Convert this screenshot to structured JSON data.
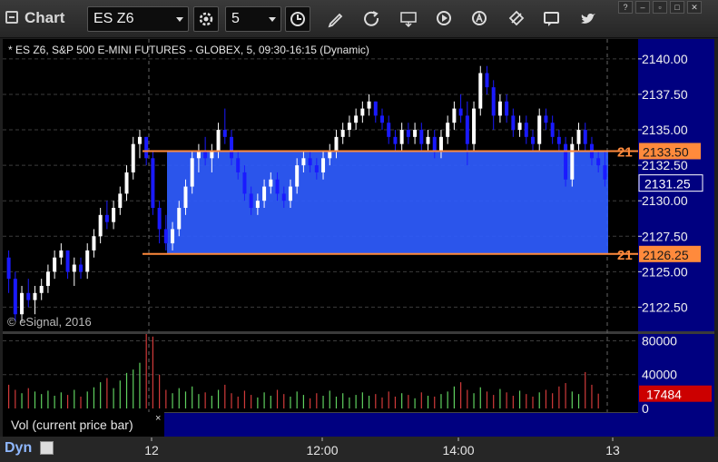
{
  "toolbar": {
    "title": "Chart",
    "symbol": "ES Z6",
    "interval": "5",
    "buttons": [
      "settings-icon",
      "clock-icon",
      "pencil-icon",
      "refresh-icon",
      "get-icon",
      "play-icon",
      "alert-icon",
      "crosshair-icon",
      "comment-icon",
      "twitter-icon"
    ],
    "window_buttons": [
      "help-icon",
      "minimize-icon",
      "maximize-icon",
      "close-icon"
    ]
  },
  "header": {
    "info": "* ES Z6, S&P 500 E-MINI FUTURES - GLOBEX, 5, 09:30-16:15 (Dynamic)",
    "copyright": "© eSignal, 2016"
  },
  "volume_pane": {
    "label": "Vol (current price bar)",
    "close_label": "×",
    "current_value": "17484"
  },
  "footer": {
    "dyn_label": "Dyn"
  },
  "colors": {
    "up": "#ffffff",
    "down": "#1a1aff",
    "box_fill": "#2f5cff",
    "level_line": "#ff8a3c",
    "vol_up": "#5fd15f",
    "vol_down": "#d13a3a",
    "axis_bg": "#000080",
    "current_price_bg": "#000080",
    "vol_value_bg": "#cc0000"
  },
  "chart_data": {
    "type": "candlestick",
    "y_axis": {
      "ticks": [
        "2140.00",
        "2137.50",
        "2135.00",
        "2132.50",
        "2130.00",
        "2127.50",
        "2125.00",
        "2122.50"
      ],
      "range": [
        2120.8,
        2141.4
      ]
    },
    "x_axis": {
      "ticks": [
        "12",
        "12:00",
        "14:00",
        "13"
      ]
    },
    "levels": [
      {
        "label": "2133.50",
        "price": 2133.5,
        "marker": "21"
      },
      {
        "label": "2126.25",
        "price": 2126.25,
        "marker": "21"
      }
    ],
    "current_price": {
      "label": "2131.25",
      "price": 2131.25
    },
    "volume_axis": {
      "ticks": [
        "80000",
        "40000",
        "0"
      ],
      "max": 88000
    },
    "candles": [
      [
        2126.0,
        2126.5,
        2123.5,
        2124.5
      ],
      [
        2124.5,
        2125.0,
        2121.5,
        2122.0
      ],
      [
        2122.0,
        2124.0,
        2121.5,
        2123.5
      ],
      [
        2123.5,
        2124.5,
        2122.5,
        2123.0
      ],
      [
        2123.0,
        2124.0,
        2122.0,
        2123.5
      ],
      [
        2123.5,
        2124.5,
        2123.0,
        2124.0
      ],
      [
        2124.0,
        2125.5,
        2123.5,
        2125.0
      ],
      [
        2125.0,
        2126.5,
        2124.5,
        2126.0
      ],
      [
        2126.0,
        2127.0,
        2125.5,
        2126.5
      ],
      [
        2126.5,
        2126.5,
        2124.5,
        2125.0
      ],
      [
        2125.0,
        2126.0,
        2124.0,
        2125.5
      ],
      [
        2125.5,
        2126.0,
        2124.5,
        2125.0
      ],
      [
        2125.0,
        2127.0,
        2124.5,
        2126.5
      ],
      [
        2126.5,
        2128.0,
        2126.0,
        2127.5
      ],
      [
        2127.5,
        2129.5,
        2127.0,
        2129.0
      ],
      [
        2129.0,
        2130.0,
        2128.0,
        2128.5
      ],
      [
        2128.5,
        2130.0,
        2128.0,
        2129.5
      ],
      [
        2129.5,
        2131.0,
        2129.0,
        2130.5
      ],
      [
        2130.5,
        2132.5,
        2130.0,
        2132.0
      ],
      [
        2132.0,
        2134.5,
        2131.5,
        2134.0
      ],
      [
        2134.0,
        2135.0,
        2133.0,
        2134.5
      ],
      [
        2134.5,
        2134.5,
        2132.5,
        2133.0
      ],
      [
        2133.0,
        2133.5,
        2129.0,
        2129.5
      ],
      [
        2129.5,
        2130.0,
        2127.0,
        2128.0
      ],
      [
        2128.0,
        2129.0,
        2126.5,
        2127.0
      ],
      [
        2127.0,
        2128.5,
        2126.5,
        2128.0
      ],
      [
        2128.0,
        2130.0,
        2127.5,
        2129.5
      ],
      [
        2129.5,
        2131.5,
        2129.0,
        2131.0
      ],
      [
        2131.0,
        2133.5,
        2130.5,
        2133.0
      ],
      [
        2133.0,
        2134.0,
        2132.0,
        2133.5
      ],
      [
        2133.5,
        2134.5,
        2132.5,
        2133.0
      ],
      [
        2133.0,
        2134.0,
        2132.0,
        2133.5
      ],
      [
        2133.5,
        2135.5,
        2133.0,
        2135.0
      ],
      [
        2135.0,
        2136.5,
        2134.0,
        2134.5
      ],
      [
        2134.5,
        2135.0,
        2132.5,
        2133.0
      ],
      [
        2133.0,
        2133.5,
        2131.5,
        2132.0
      ],
      [
        2132.0,
        2132.5,
        2130.0,
        2130.5
      ],
      [
        2130.5,
        2131.0,
        2129.0,
        2129.5
      ],
      [
        2129.5,
        2130.5,
        2129.0,
        2130.0
      ],
      [
        2130.0,
        2131.5,
        2129.5,
        2131.0
      ],
      [
        2131.0,
        2132.0,
        2130.5,
        2131.5
      ],
      [
        2131.5,
        2132.0,
        2130.0,
        2130.5
      ],
      [
        2130.5,
        2131.0,
        2129.5,
        2130.0
      ],
      [
        2130.0,
        2131.5,
        2129.5,
        2131.0
      ],
      [
        2131.0,
        2133.0,
        2130.5,
        2132.5
      ],
      [
        2132.5,
        2133.5,
        2132.0,
        2133.0
      ],
      [
        2133.0,
        2133.5,
        2132.0,
        2132.5
      ],
      [
        2132.5,
        2133.0,
        2131.5,
        2132.0
      ],
      [
        2132.0,
        2133.5,
        2131.5,
        2133.0
      ],
      [
        2133.0,
        2134.0,
        2132.5,
        2133.5
      ],
      [
        2133.5,
        2135.0,
        2133.0,
        2134.5
      ],
      [
        2134.5,
        2135.5,
        2134.0,
        2135.0
      ],
      [
        2135.0,
        2136.0,
        2134.5,
        2135.5
      ],
      [
        2135.5,
        2136.5,
        2135.0,
        2136.0
      ],
      [
        2136.0,
        2137.0,
        2135.5,
        2136.5
      ],
      [
        2136.5,
        2137.5,
        2136.0,
        2137.0
      ],
      [
        2137.0,
        2137.0,
        2135.5,
        2136.0
      ],
      [
        2136.0,
        2136.5,
        2135.0,
        2135.5
      ],
      [
        2135.5,
        2136.0,
        2134.0,
        2134.5
      ],
      [
        2134.5,
        2135.0,
        2133.5,
        2134.0
      ],
      [
        2134.0,
        2135.5,
        2133.5,
        2135.0
      ],
      [
        2135.0,
        2135.5,
        2134.0,
        2134.5
      ],
      [
        2134.5,
        2135.5,
        2134.0,
        2135.0
      ],
      [
        2135.0,
        2135.5,
        2133.5,
        2134.0
      ],
      [
        2134.0,
        2135.0,
        2133.5,
        2134.5
      ],
      [
        2134.5,
        2135.0,
        2133.0,
        2133.5
      ],
      [
        2133.5,
        2135.0,
        2133.0,
        2134.5
      ],
      [
        2134.5,
        2136.0,
        2134.0,
        2135.5
      ],
      [
        2135.5,
        2137.0,
        2135.0,
        2136.5
      ],
      [
        2136.5,
        2137.5,
        2135.5,
        2136.0
      ],
      [
        2136.0,
        2137.0,
        2132.5,
        2134.0
      ],
      [
        2134.0,
        2137.0,
        2133.5,
        2136.5
      ],
      [
        2136.5,
        2139.5,
        2136.0,
        2139.0
      ],
      [
        2139.0,
        2139.5,
        2137.5,
        2138.0
      ],
      [
        2138.0,
        2138.5,
        2135.0,
        2136.0
      ],
      [
        2136.0,
        2137.5,
        2135.5,
        2137.0
      ],
      [
        2137.0,
        2137.5,
        2135.5,
        2136.0
      ],
      [
        2136.0,
        2136.5,
        2134.5,
        2135.0
      ],
      [
        2135.0,
        2136.0,
        2134.5,
        2135.5
      ],
      [
        2135.5,
        2136.0,
        2134.0,
        2134.5
      ],
      [
        2134.5,
        2135.0,
        2133.5,
        2134.0
      ],
      [
        2134.0,
        2136.5,
        2133.5,
        2136.0
      ],
      [
        2136.0,
        2136.5,
        2135.0,
        2135.5
      ],
      [
        2135.5,
        2136.0,
        2134.0,
        2134.5
      ],
      [
        2134.5,
        2135.0,
        2133.5,
        2134.0
      ],
      [
        2134.0,
        2134.5,
        2131.0,
        2131.5
      ],
      [
        2131.5,
        2134.5,
        2131.0,
        2134.0
      ],
      [
        2134.0,
        2135.5,
        2133.5,
        2135.0
      ],
      [
        2135.0,
        2135.5,
        2133.5,
        2134.0
      ],
      [
        2134.0,
        2134.5,
        2132.5,
        2133.0
      ],
      [
        2133.0,
        2133.5,
        2132.0,
        2132.5
      ],
      [
        2132.5,
        2133.5,
        2131.0,
        2131.5
      ]
    ],
    "volumes": [
      28000,
      22000,
      18000,
      24000,
      20000,
      17000,
      21000,
      15000,
      19000,
      16000,
      22000,
      14000,
      20000,
      25000,
      31000,
      36000,
      24000,
      33000,
      42000,
      46000,
      54000,
      88000,
      85000,
      40000,
      22000,
      18000,
      24000,
      20000,
      26000,
      17000,
      19000,
      15000,
      22000,
      28000,
      18000,
      14000,
      21000,
      16000,
      13000,
      19000,
      15000,
      22000,
      17000,
      14000,
      20000,
      16000,
      12000,
      18000,
      15000,
      21000,
      14000,
      18000,
      13000,
      16000,
      19000,
      15000,
      17000,
      13000,
      20000,
      14000,
      18000,
      16000,
      12000,
      19000,
      15000,
      14000,
      17000,
      20000,
      26000,
      31000,
      22000,
      18000,
      25000,
      20000,
      16000,
      23000,
      19000,
      15000,
      21000,
      17000,
      14000,
      19000,
      22000,
      18000,
      26000,
      30000,
      20000,
      17000,
      43000,
      28000,
      17484
    ]
  }
}
